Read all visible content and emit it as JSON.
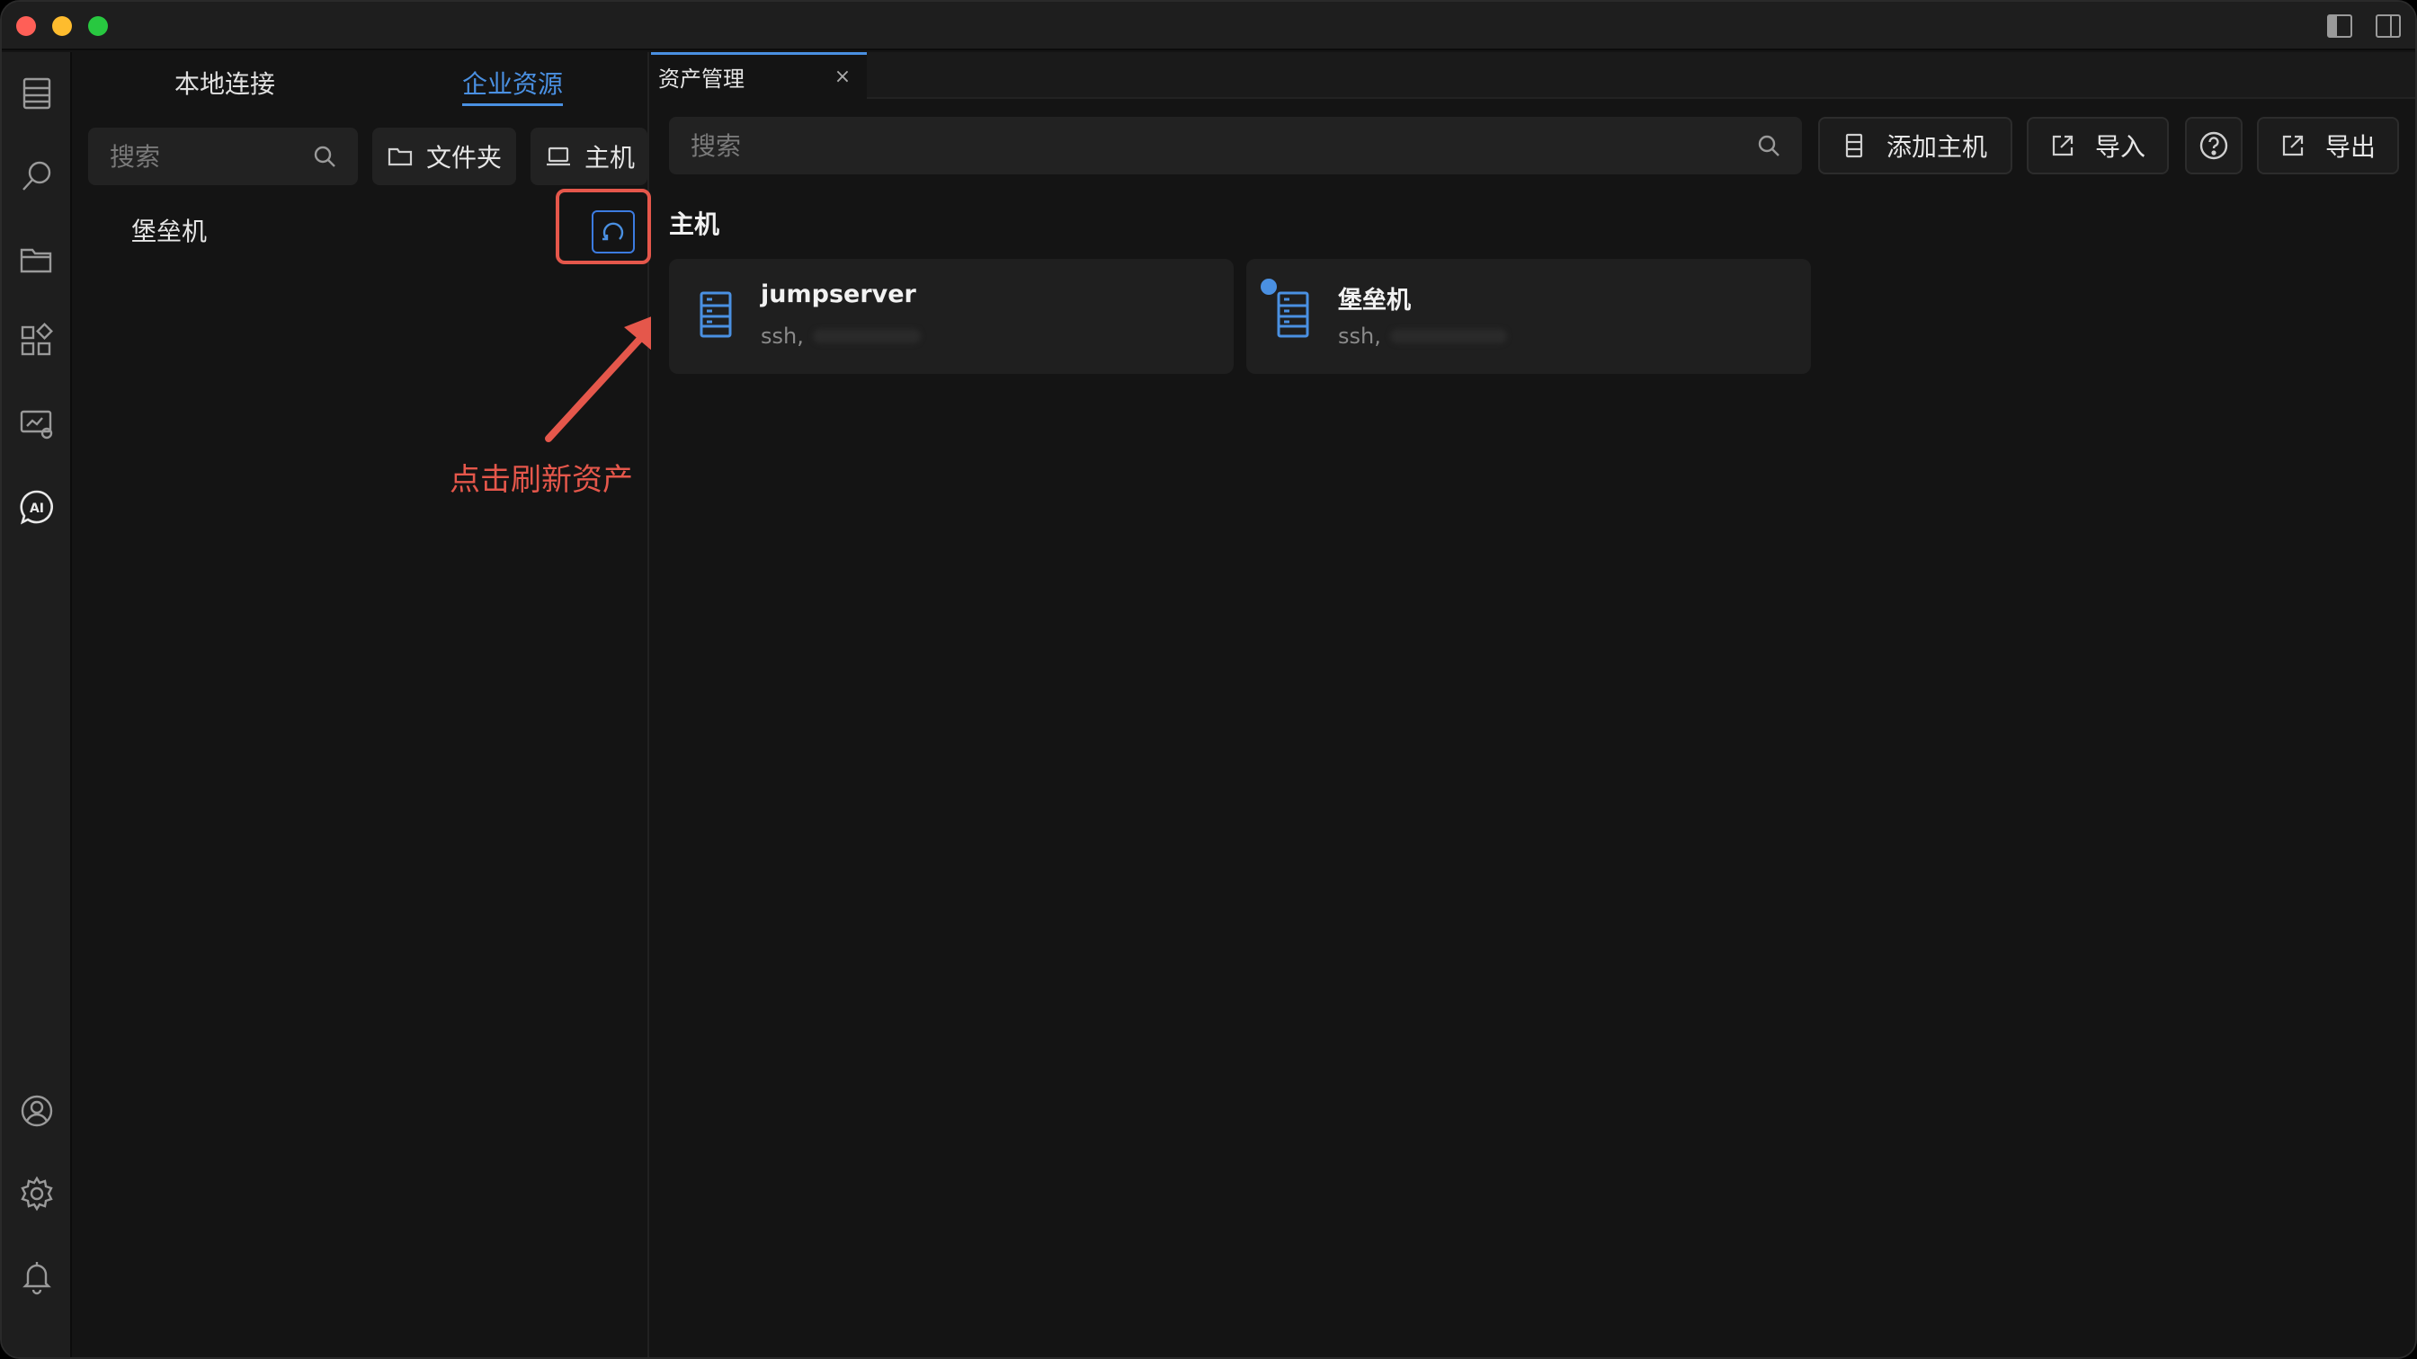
{
  "sidebar": {
    "tabs": [
      {
        "label": "本地连接",
        "active": false
      },
      {
        "label": "企业资源",
        "active": true
      }
    ],
    "search_placeholder": "搜索",
    "folder_button": "文件夹",
    "host_button": "主机",
    "tree_items": [
      "堡垒机"
    ]
  },
  "annotation": {
    "text": "点击刷新资产",
    "color": "#e5574b"
  },
  "editor": {
    "tab_label": "资产管理",
    "tab_close": "×",
    "search_placeholder": "搜索",
    "toolbar": {
      "add_host": "添加主机",
      "import": "导入",
      "export": "导出"
    },
    "section_title": "主机",
    "hosts": [
      {
        "name": "jumpserver",
        "sub": "ssh,"
      },
      {
        "name": "堡垒机",
        "sub": "ssh,",
        "linked": true
      }
    ]
  },
  "colors": {
    "accent": "#4a90e2",
    "background": "#141414",
    "panel": "#1e1e1e"
  }
}
